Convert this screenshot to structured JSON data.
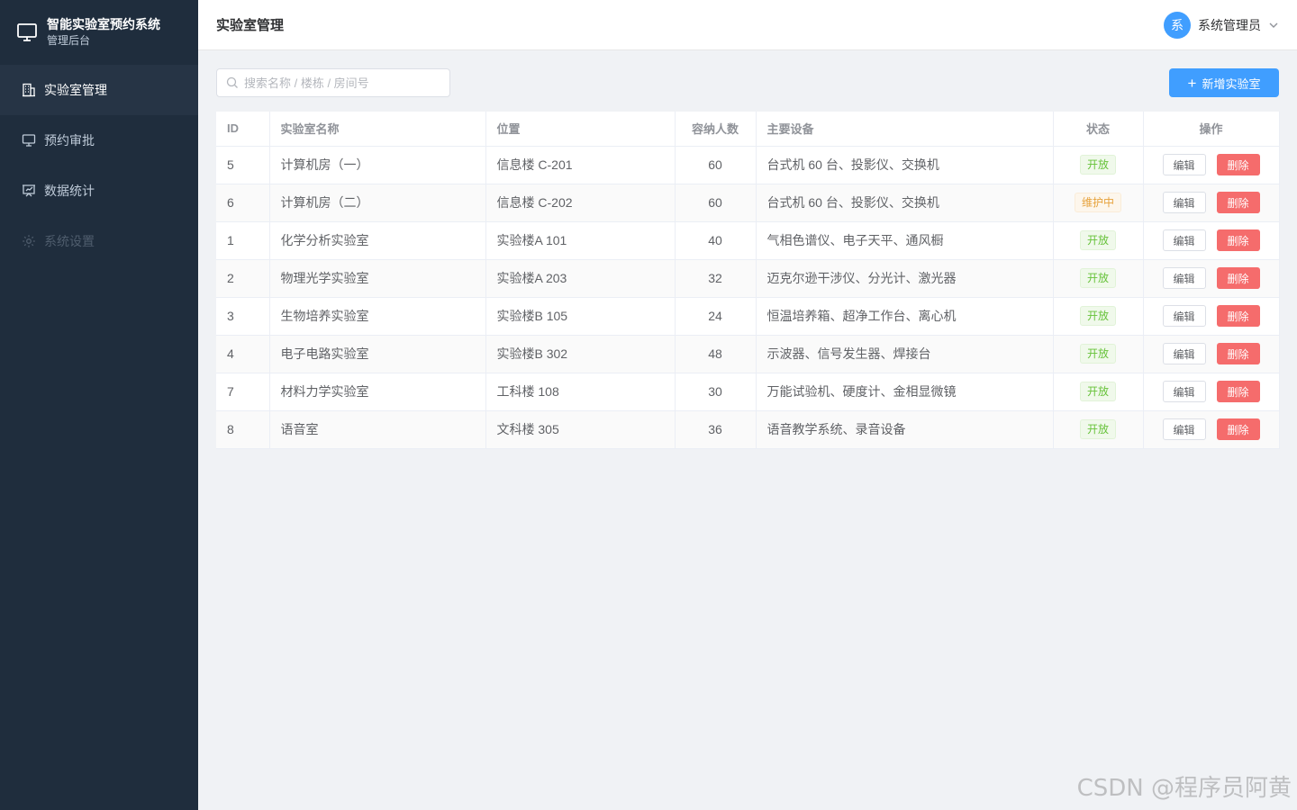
{
  "brand": {
    "title": "智能实验室预约系统",
    "subtitle": "管理后台",
    "icon": "monitor-icon"
  },
  "sidebar": {
    "items": [
      {
        "label": "实验室管理",
        "icon": "building-icon",
        "active": true
      },
      {
        "label": "预约审批",
        "icon": "monitor-icon"
      },
      {
        "label": "数据统计",
        "icon": "presentation-chart-icon"
      },
      {
        "label": "系统设置",
        "icon": "gear-icon",
        "disabled": true
      }
    ]
  },
  "header": {
    "title": "实验室管理",
    "avatar_text": "系",
    "user_name": "系统管理员"
  },
  "toolbar": {
    "search_placeholder": "搜索名称 / 楼栋 / 房间号",
    "add_label": "新增实验室"
  },
  "table": {
    "columns": [
      "ID",
      "实验室名称",
      "位置",
      "容纳人数",
      "主要设备",
      "状态",
      "操作"
    ],
    "rows": [
      {
        "id": "5",
        "name": "计算机房（一）",
        "location": "信息楼 C-201",
        "capacity": "60",
        "equipment": "台式机 60 台、投影仪、交换机",
        "status": "开放",
        "status_type": "open"
      },
      {
        "id": "6",
        "name": "计算机房（二）",
        "location": "信息楼 C-202",
        "capacity": "60",
        "equipment": "台式机 60 台、投影仪、交换机",
        "status": "维护中",
        "status_type": "maint"
      },
      {
        "id": "1",
        "name": "化学分析实验室",
        "location": "实验楼A 101",
        "capacity": "40",
        "equipment": "气相色谱仪、电子天平、通风橱",
        "status": "开放",
        "status_type": "open"
      },
      {
        "id": "2",
        "name": "物理光学实验室",
        "location": "实验楼A 203",
        "capacity": "32",
        "equipment": "迈克尔逊干涉仪、分光计、激光器",
        "status": "开放",
        "status_type": "open"
      },
      {
        "id": "3",
        "name": "生物培养实验室",
        "location": "实验楼B 105",
        "capacity": "24",
        "equipment": "恒温培养箱、超净工作台、离心机",
        "status": "开放",
        "status_type": "open"
      },
      {
        "id": "4",
        "name": "电子电路实验室",
        "location": "实验楼B 302",
        "capacity": "48",
        "equipment": "示波器、信号发生器、焊接台",
        "status": "开放",
        "status_type": "open"
      },
      {
        "id": "7",
        "name": "材料力学实验室",
        "location": "工科楼 108",
        "capacity": "30",
        "equipment": "万能试验机、硬度计、金相显微镜",
        "status": "开放",
        "status_type": "open"
      },
      {
        "id": "8",
        "name": "语音室",
        "location": "文科楼 305",
        "capacity": "36",
        "equipment": "语音教学系统、录音设备",
        "status": "开放",
        "status_type": "open"
      }
    ],
    "edit_label": "编辑",
    "delete_label": "删除"
  },
  "watermark": "CSDN @程序员阿黄",
  "colors": {
    "sidebar_bg": "#1f2d3d",
    "primary": "#409eff",
    "danger": "#f56c6c",
    "success": "#67c23a",
    "warning": "#e6a23c"
  }
}
